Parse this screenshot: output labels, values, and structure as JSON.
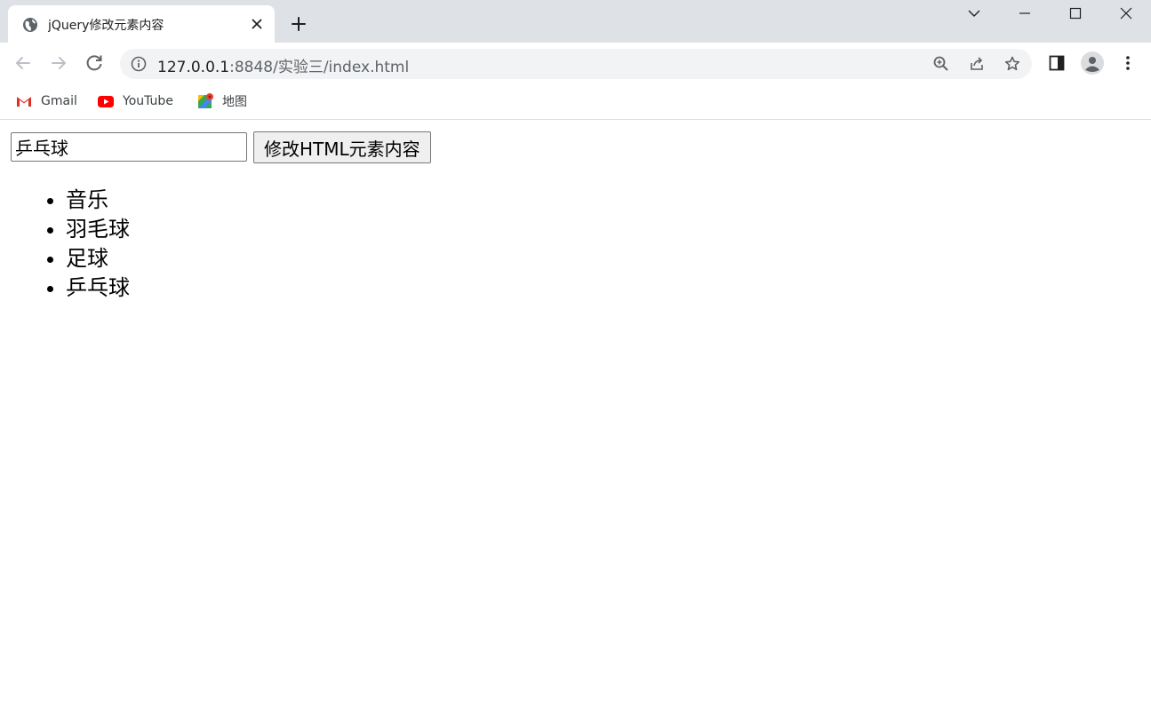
{
  "browser": {
    "tab": {
      "title": "jQuery修改元素内容"
    },
    "address_bar": {
      "host": "127.0.0.1",
      "path": ":8848/实验三/index.html"
    },
    "bookmarks": [
      {
        "label": "Gmail",
        "icon": "gmail-icon"
      },
      {
        "label": "YouTube",
        "icon": "youtube-icon"
      },
      {
        "label": "地图",
        "icon": "maps-icon"
      }
    ],
    "colors": {
      "tabstrip": "#dee1e6",
      "omnibox": "#f1f3f4",
      "youtube_red": "#ff0000"
    }
  },
  "page": {
    "input": {
      "value": "乒乓球"
    },
    "button_label": "修改HTML元素内容",
    "list": [
      "音乐",
      "羽毛球",
      "足球",
      "乒乓球"
    ]
  }
}
